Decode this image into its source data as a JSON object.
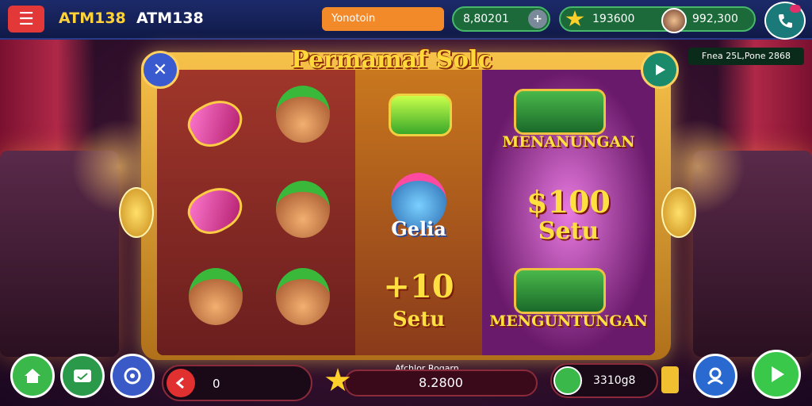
{
  "header": {
    "brand_primary": "ATM138",
    "brand_secondary": "ATM138",
    "search_placeholder": "Yonotoin",
    "balance": "8,80201",
    "balance_add": "+",
    "coins": "193600",
    "coins_secondary": "992,300"
  },
  "game": {
    "title": "Permamaf Solc",
    "info_bar": "Fnea 25L,Pone  2868",
    "reel_texts": {
      "gelia": "Gelia",
      "plus10": "+10",
      "setu_a": "Setu",
      "bonus1": "MENANUNGAN",
      "prize": "$100",
      "setu_b": "Setu",
      "bonus2": "MENGUNTUNGAN"
    }
  },
  "footer": {
    "bet_value": "0",
    "win_label": "Afchlor Rogarn",
    "win_value": "8.2800",
    "credit_value": "3310g8"
  },
  "colors": {
    "topbar": "#101a48",
    "accent_orange": "#f28a2a",
    "accent_gold": "#ffd83a",
    "button_green": "#3ab84a"
  }
}
